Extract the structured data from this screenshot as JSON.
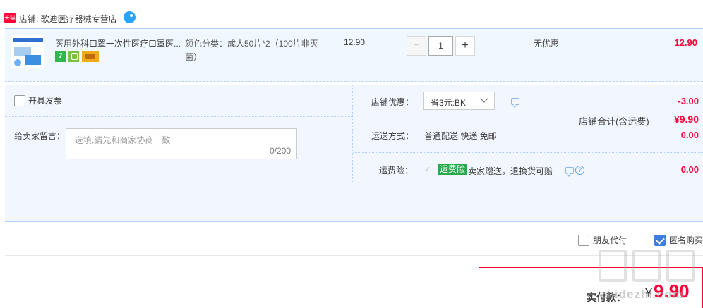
{
  "shop": {
    "badge": "天猫",
    "name": "店铺: 歌迪医疗器械专营店"
  },
  "item": {
    "title": "医用外科口罩一次性医疗口罩医...",
    "sku": "颜色分类：成人50片*2（100片非灭菌）",
    "unit_price": "12.90",
    "quantity": "1",
    "minus": "−",
    "plus": "+",
    "discount": "无优惠",
    "total": "12.90",
    "service_badge_7": "7"
  },
  "options": {
    "invoice_label": "开具发票",
    "message_label": "给卖家留言：",
    "message_placeholder": "选填,请先和商家协商一致",
    "message_count": "0/200",
    "shop_discount_label": "店铺优惠：",
    "shop_discount_value": "省3元:BK",
    "shop_discount_amount": "-3.00",
    "shipping_label": "运送方式：",
    "shipping_value": "普通配送 快递 免邮",
    "shipping_amount": "0.00",
    "insurance_label": "运费险：",
    "insurance_tag": "运费险",
    "insurance_text": "卖家赠送，退换货可赔",
    "insurance_amount": "0.00",
    "help_mark": "?"
  },
  "subtotal": {
    "label": "店铺合计(含运费)",
    "amount": "¥9.90"
  },
  "footer": {
    "friend_pay_label": "朋友代付",
    "anon_buy_label": "匿名购买",
    "anon_buy_checked": true,
    "pay_label": "实付款：",
    "pay_yen": "¥",
    "pay_amount": "9.90"
  },
  "watermark": {
    "domain": "zhidezhi.com"
  },
  "colors": {
    "price_red": "#ff0036",
    "row_blue": "#f0f8ff",
    "border_blue": "#b2d1ff",
    "check_blue": "#3d7ede",
    "tag_green": "#2aa84c"
  },
  "icons": {
    "tmall": "tmall-badge-icon",
    "wangwang": "wangwang-chat-icon",
    "chat": "message-icon",
    "help": "question-icon",
    "select_arrow": "chevron-down-icon"
  }
}
